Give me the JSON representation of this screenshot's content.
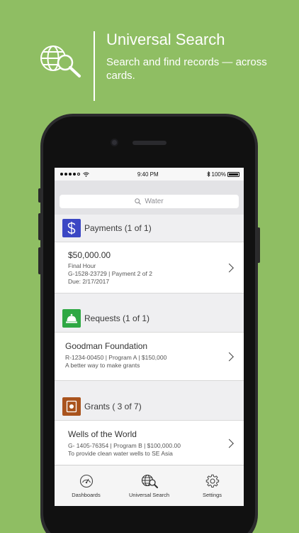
{
  "promo": {
    "title": "Universal Search",
    "subtitle": "Search and find records — across cards."
  },
  "status": {
    "time": "9:40 PM",
    "battery": "100%"
  },
  "search": {
    "value": "Water",
    "icon": "search-icon"
  },
  "sections": {
    "payments": {
      "title": "Payments (1 of 1)",
      "icon": "dollar-icon",
      "color": "#3b47c4",
      "item": {
        "title": "$50,000.00",
        "line1": "Final Hour",
        "line2": "G-1528-23729 | Payment 2 of 2",
        "line3": "Due: 2/17/2017"
      }
    },
    "requests": {
      "title": "Requests (1 of 1)",
      "icon": "service-bell-icon",
      "color": "#2ea843",
      "item": {
        "title": "Goodman Foundation",
        "line1": "R-1234-00450 | Program A | $150,000",
        "line2": "A better way to make grants"
      }
    },
    "grants": {
      "title": "Grants ( 3 of 7)",
      "icon": "grant-icon",
      "color": "#a9531d",
      "item": {
        "title": "Wells of the World",
        "line1": "G- 1405-76354 | Program B | $100,000.00",
        "line2": "To provide clean water wells to SE Asia"
      }
    }
  },
  "tabs": [
    {
      "label": "Dashboards",
      "icon": "dashboard-gauge-icon"
    },
    {
      "label": "Universal Search",
      "icon": "globe-search-icon"
    },
    {
      "label": "Settings",
      "icon": "gear-icon"
    }
  ]
}
